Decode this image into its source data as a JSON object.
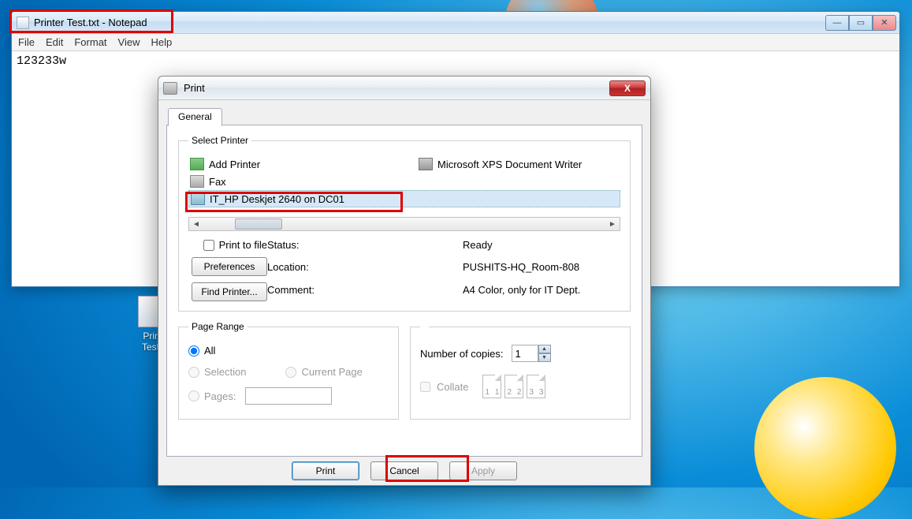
{
  "notepad": {
    "title": "Printer Test.txt - Notepad",
    "menus": [
      "File",
      "Edit",
      "Format",
      "View",
      "Help"
    ],
    "content": "123233w"
  },
  "desktop_icon": {
    "label": "Printer\nTest.txt"
  },
  "print_dialog": {
    "title": "Print",
    "tab": "General",
    "select_printer": {
      "legend": "Select Printer",
      "items": {
        "add": "Add Printer",
        "fax": "Fax",
        "selected": "IT_HP Deskjet 2640 on DC01",
        "xps": "Microsoft XPS Document Writer"
      }
    },
    "status": {
      "status_label": "Status:",
      "status_value": "Ready",
      "location_label": "Location:",
      "location_value": "PUSHITS-HQ_Room-808",
      "comment_label": "Comment:",
      "comment_value": "A4 Color, only for IT Dept."
    },
    "print_to_file": "Print to file",
    "preferences_btn": "Preferences",
    "find_printer_btn": "Find Printer...",
    "page_range": {
      "legend": "Page Range",
      "all": "All",
      "selection": "Selection",
      "current": "Current Page",
      "pages": "Pages:"
    },
    "copies": {
      "label": "Number of copies:",
      "value": "1",
      "collate": "Collate",
      "sheet_nums": [
        "1",
        "1",
        "2",
        "2",
        "3",
        "3"
      ]
    },
    "buttons": {
      "print": "Print",
      "cancel": "Cancel",
      "apply": "Apply"
    }
  }
}
